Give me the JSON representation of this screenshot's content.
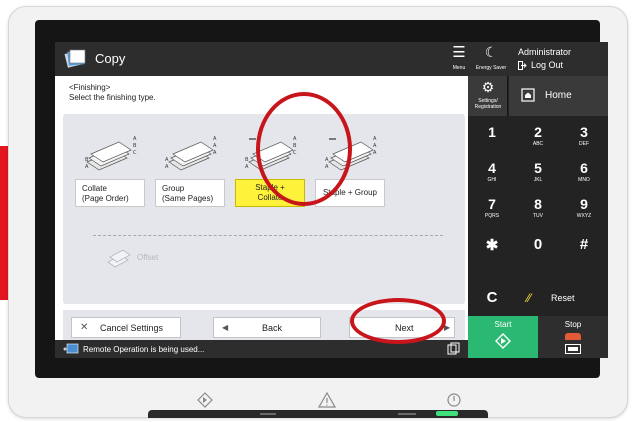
{
  "header": {
    "title": "Copy",
    "menu_label": "Menu",
    "energy_label": "Energy Saver"
  },
  "account": {
    "user": "Administrator",
    "logout_label": "Log Out"
  },
  "instructions": {
    "line1": "<Finishing>",
    "line2": "Select the finishing type."
  },
  "finishing_options": [
    {
      "line1": "Collate",
      "line2": "(Page Order)",
      "selected": false
    },
    {
      "line1": "Group",
      "line2": "(Same Pages)",
      "selected": false
    },
    {
      "line1": "Staple + Collate",
      "line2": "",
      "selected": true
    },
    {
      "line1": "Staple + Group",
      "line2": "",
      "selected": false
    }
  ],
  "offset_label": "Offset",
  "footer": {
    "cancel_label": "Cancel Settings",
    "back_label": "Back",
    "next_label": "Next"
  },
  "status": {
    "message": "Remote Operation is being used..."
  },
  "keypad": {
    "settings_label_1": "Settings/",
    "settings_label_2": "Registration",
    "home_label": "Home",
    "keys": [
      {
        "d": "1",
        "s": ""
      },
      {
        "d": "2",
        "s": "ABC"
      },
      {
        "d": "3",
        "s": "DEF"
      },
      {
        "d": "4",
        "s": "GHI"
      },
      {
        "d": "5",
        "s": "JKL"
      },
      {
        "d": "6",
        "s": "MNO"
      },
      {
        "d": "7",
        "s": "PQRS"
      },
      {
        "d": "8",
        "s": "TUV"
      },
      {
        "d": "9",
        "s": "WXYZ"
      },
      {
        "d": "✱",
        "s": ""
      },
      {
        "d": "0",
        "s": ""
      },
      {
        "d": "#",
        "s": ""
      }
    ],
    "clear_label": "C",
    "reset_label": "Reset",
    "start_label": "Start",
    "stop_label": "Stop"
  },
  "colors": {
    "selected": "#fff23b",
    "start": "#2bb873",
    "stop_icon": "#e35a36",
    "annotation": "#c8151c"
  }
}
